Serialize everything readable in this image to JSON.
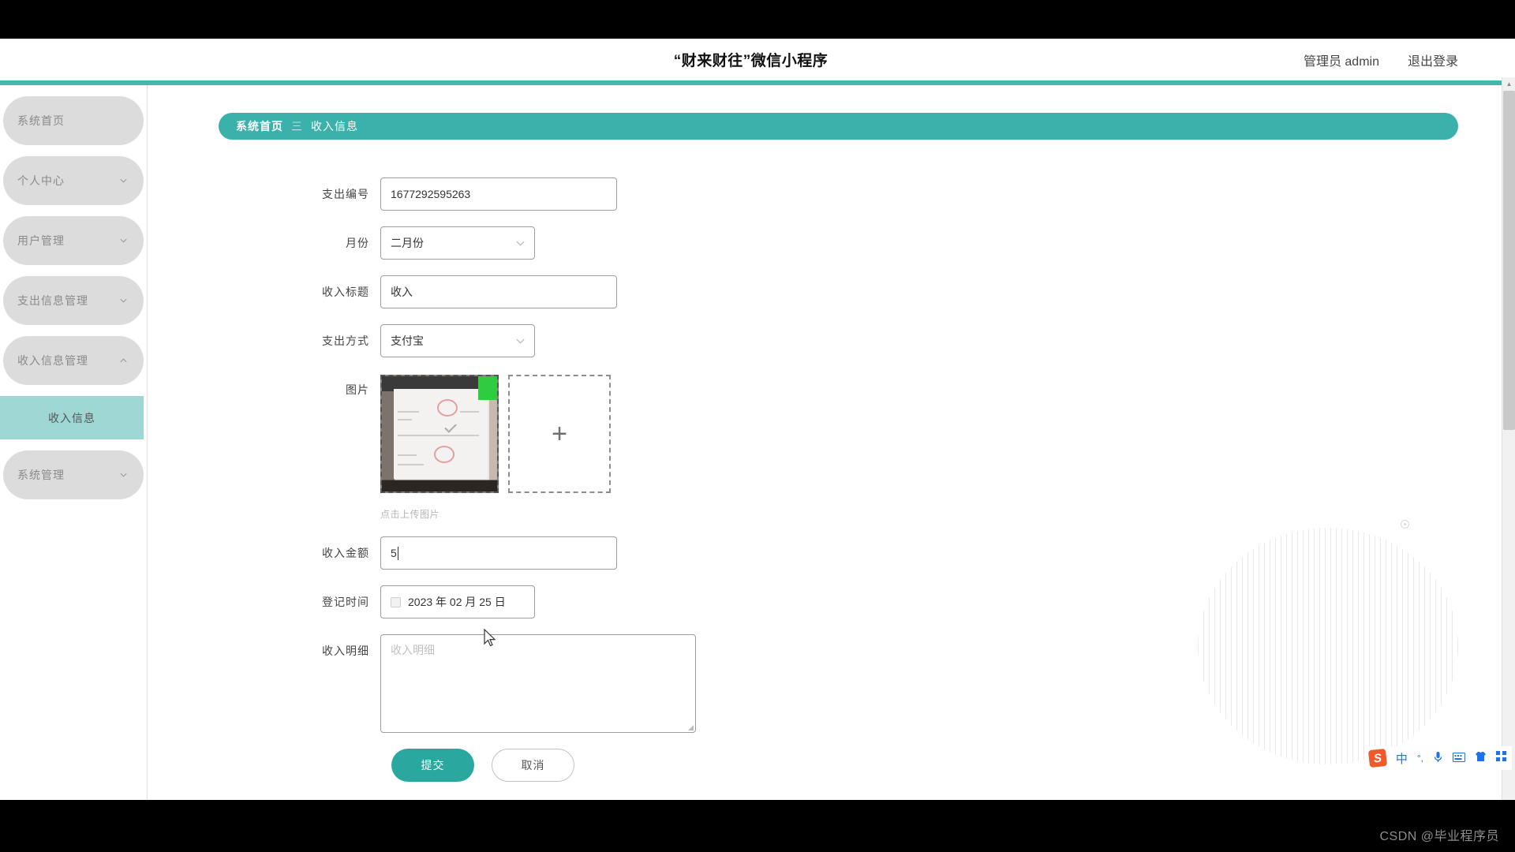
{
  "header": {
    "brand_title": "“财来财往”微信小程序",
    "user_label": "管理员 admin",
    "logout_label": "退出登录",
    "accent_color": "#45b7b0"
  },
  "sidebar": {
    "items": [
      {
        "label": "系统首页",
        "expandable": false,
        "icon": ""
      },
      {
        "label": "个人中心",
        "expandable": true,
        "icon": "chevron-down-icon"
      },
      {
        "label": "用户管理",
        "expandable": true,
        "icon": "chevron-down-icon"
      },
      {
        "label": "支出信息管理",
        "expandable": true,
        "icon": "chevron-down-icon"
      },
      {
        "label": "收入信息管理",
        "expandable": true,
        "icon": "chevron-up-icon"
      }
    ],
    "sub_item": {
      "label": "收入信息",
      "active": true,
      "active_color": "#9ed7d4"
    },
    "last_item": {
      "label": "系统管理",
      "expandable": true,
      "icon": "chevron-down-icon"
    }
  },
  "breadcrumb": {
    "home": "系统首页",
    "separator": "三",
    "current": "收入信息",
    "background": "#3ab2ab"
  },
  "form": {
    "fields": [
      {
        "label": "支出编号",
        "value": "1677292595263",
        "type": "text"
      },
      {
        "label": "月份",
        "value": "二月份",
        "type": "select"
      },
      {
        "label": "收入标题",
        "value": "收入",
        "type": "text"
      },
      {
        "label": "支出方式",
        "value": "支付宝",
        "type": "select"
      }
    ],
    "image_field": {
      "label": "图片",
      "add_label": "+",
      "hint": "点击上传图片"
    },
    "amount": {
      "label": "收入金额",
      "value": "5",
      "type": "text"
    },
    "date": {
      "label": "登记时间",
      "value": "2023 年 02 月 25 日",
      "type": "date",
      "icon": "calendar-icon"
    },
    "detail": {
      "label": "收入明细",
      "value": "",
      "placeholder": "收入明细",
      "type": "textarea"
    },
    "submit_label": "提交",
    "cancel_label": "取消"
  },
  "ime": {
    "logo": "S",
    "mode": "中",
    "punctuation": "°,",
    "mic": "mic-icon",
    "keyboard": "keyboard-icon",
    "skin": "skin-icon",
    "apps": "apps-icon"
  },
  "watermark": "CSDN @毕业程序员"
}
